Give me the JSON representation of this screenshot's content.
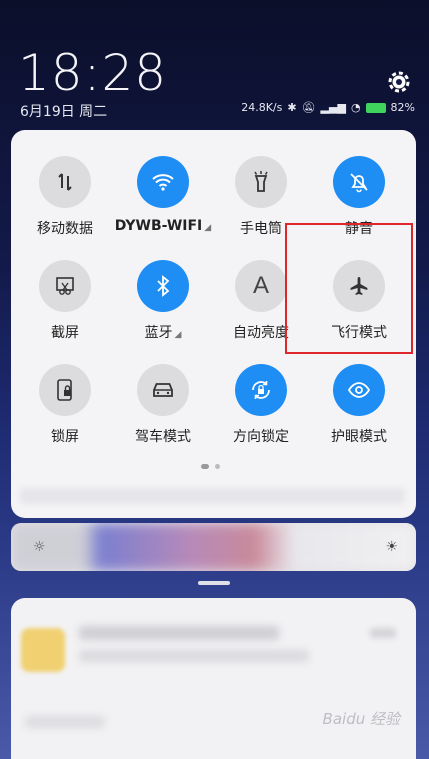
{
  "lock": {
    "time": "18:28",
    "date": "6月19日 周二"
  },
  "status": {
    "speed": "24.8K/s",
    "battery": "82%"
  },
  "tiles": [
    {
      "label": "移动数据",
      "icon": "mobile-data-icon",
      "on": false,
      "arrow": false
    },
    {
      "label": "DYWB-WIFI",
      "icon": "wifi-icon",
      "on": true,
      "arrow": true
    },
    {
      "label": "手电筒",
      "icon": "flashlight-icon",
      "on": false,
      "arrow": false
    },
    {
      "label": "静音",
      "icon": "bell-off-icon",
      "on": true,
      "arrow": false
    },
    {
      "label": "截屏",
      "icon": "screenshot-icon",
      "on": false,
      "arrow": false
    },
    {
      "label": "蓝牙",
      "icon": "bluetooth-icon",
      "on": true,
      "arrow": true
    },
    {
      "label": "自动亮度",
      "icon": "auto-brightness-icon",
      "on": false,
      "arrow": false
    },
    {
      "label": "飞行模式",
      "icon": "airplane-icon",
      "on": false,
      "arrow": false
    },
    {
      "label": "锁屏",
      "icon": "lock-screen-icon",
      "on": false,
      "arrow": false
    },
    {
      "label": "驾车模式",
      "icon": "car-icon",
      "on": false,
      "arrow": false
    },
    {
      "label": "方向锁定",
      "icon": "rotation-lock-icon",
      "on": true,
      "arrow": false
    },
    {
      "label": "护眼模式",
      "icon": "eye-icon",
      "on": true,
      "arrow": false
    }
  ],
  "watermark": "Baidu 经验",
  "colors": {
    "accent": "#1e8ef5",
    "tile_off": "#dcdcde",
    "highlight": "#e0262d"
  }
}
